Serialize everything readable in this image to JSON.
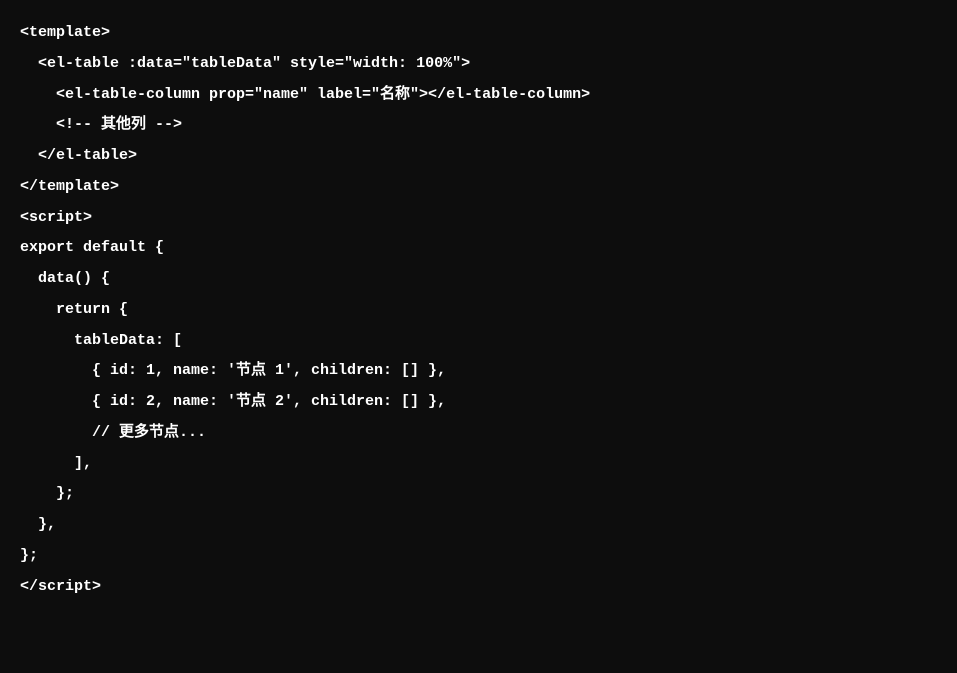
{
  "code": {
    "lines": [
      "<template>",
      "  <el-table :data=\"tableData\" style=\"width: 100%\">",
      "    <el-table-column prop=\"name\" label=\"名称\"></el-table-column>",
      "    <!-- 其他列 -->",
      "  </el-table>",
      "</template>",
      "",
      "<script>",
      "export default {",
      "  data() {",
      "    return {",
      "      tableData: [",
      "        { id: 1, name: '节点 1', children: [] },",
      "        { id: 2, name: '节点 2', children: [] },",
      "        // 更多节点...",
      "      ],",
      "    };",
      "  },",
      "};",
      "</script>"
    ]
  }
}
